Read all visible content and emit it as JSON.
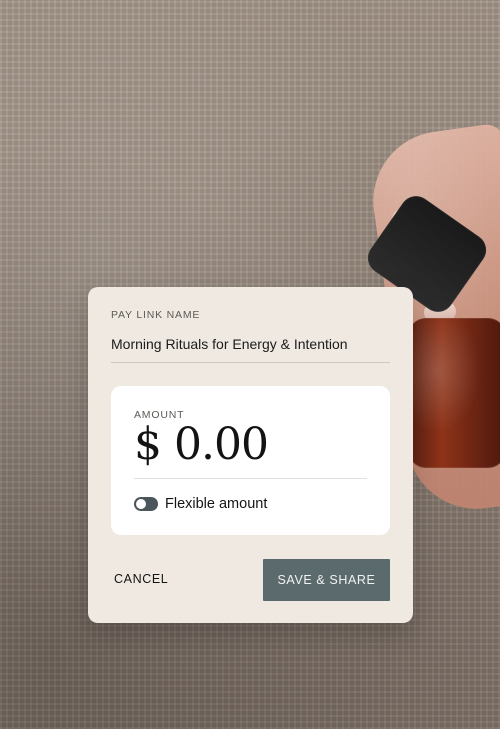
{
  "modal": {
    "pay_link_name_label": "PAY LINK NAME",
    "pay_link_name_value": "Morning Rituals for Energy & Intention",
    "amount_label": "AMOUNT",
    "amount_value": "$ 0.00",
    "flexible_amount_label": "Flexible amount",
    "cancel_label": "CANCEL",
    "save_label": "SAVE & SHARE"
  },
  "theme": {
    "card_bg": "#efe9e1",
    "panel_bg": "#ffffff",
    "primary_button": "#5b6a6d",
    "toggle_bg": "#4b565b"
  },
  "icons": {
    "toggle": "toggle-switch"
  }
}
